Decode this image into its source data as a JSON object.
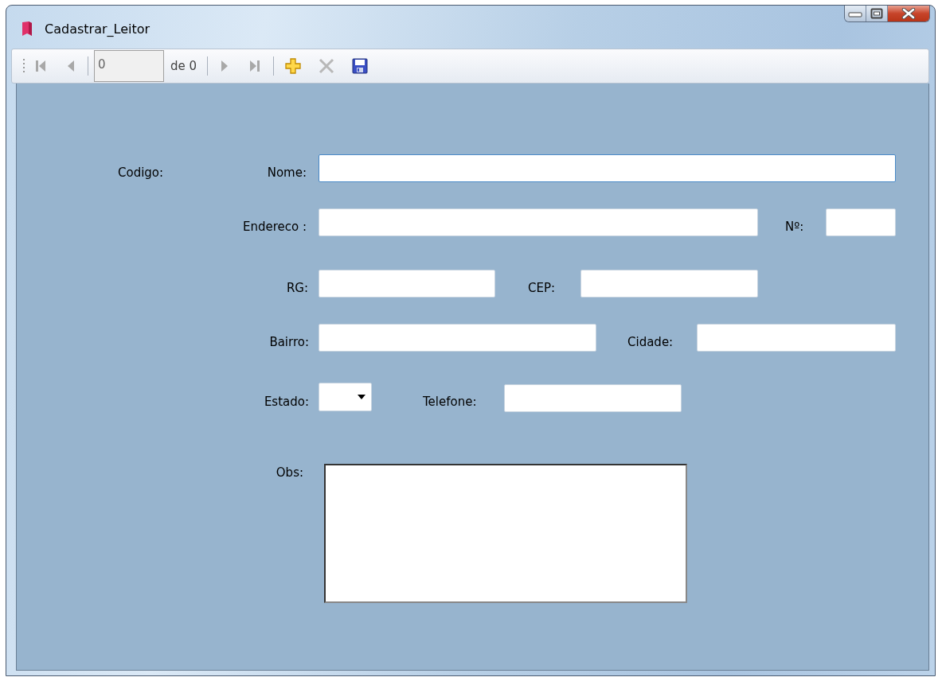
{
  "window": {
    "title": "Cadastrar_Leitor"
  },
  "toolbar": [
    {
      "kind": "first",
      "disabled": true
    },
    {
      "kind": "previous",
      "disabled": true
    },
    {
      "kind": "separator"
    },
    {
      "kind": "position",
      "value": "0"
    },
    {
      "kind": "count",
      "text": "de 0"
    },
    {
      "kind": "separator"
    },
    {
      "kind": "next",
      "disabled": true
    },
    {
      "kind": "last",
      "disabled": true
    },
    {
      "kind": "separator"
    },
    {
      "kind": "add",
      "disabled": false
    },
    {
      "kind": "delete",
      "disabled": true
    },
    {
      "kind": "save",
      "disabled": false
    }
  ],
  "form": {
    "fields": [
      {
        "kind": "label",
        "label": "Codigo:"
      },
      {
        "kind": "text",
        "label": "Nome:",
        "focused": true
      },
      {
        "kind": "text",
        "label": "Endereco :",
        "focused": false
      },
      {
        "kind": "text",
        "label": "Nº:",
        "focused": false
      },
      {
        "kind": "text",
        "label": "RG:",
        "focused": false
      },
      {
        "kind": "text",
        "label": "CEP:",
        "focused": false
      },
      {
        "kind": "text",
        "label": "Bairro:",
        "focused": false
      },
      {
        "kind": "text",
        "label": "Cidade:",
        "focused": false
      },
      {
        "kind": "combo",
        "label": "Estado:",
        "focused": false
      },
      {
        "kind": "text",
        "label": "Telefone:",
        "focused": false
      },
      {
        "kind": "textarea",
        "label": "Obs:",
        "focused": false
      }
    ]
  }
}
